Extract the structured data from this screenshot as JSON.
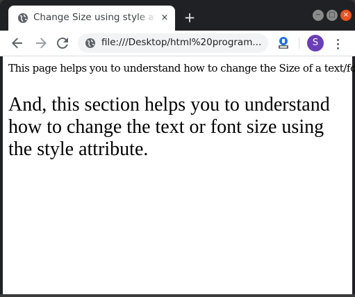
{
  "browser": {
    "tab": {
      "title": "Change Size using style at",
      "close_label": "×"
    },
    "new_tab_label": "+",
    "window_controls": {
      "minimize": "−",
      "maximize": "□",
      "close": "×"
    },
    "toolbar": {
      "url": "file:///Desktop/html%20program...",
      "profile_initial": "S"
    }
  },
  "page": {
    "paragraph_small": "This page helps you to understand how to change the Size of a text/font.",
    "paragraph_large": "And, this section helps you to understand how to change the text or font size using the style attribute."
  },
  "colors": {
    "accent_close": "#e95420",
    "avatar": "#6a3fb5",
    "tab_strip": "#202124"
  }
}
